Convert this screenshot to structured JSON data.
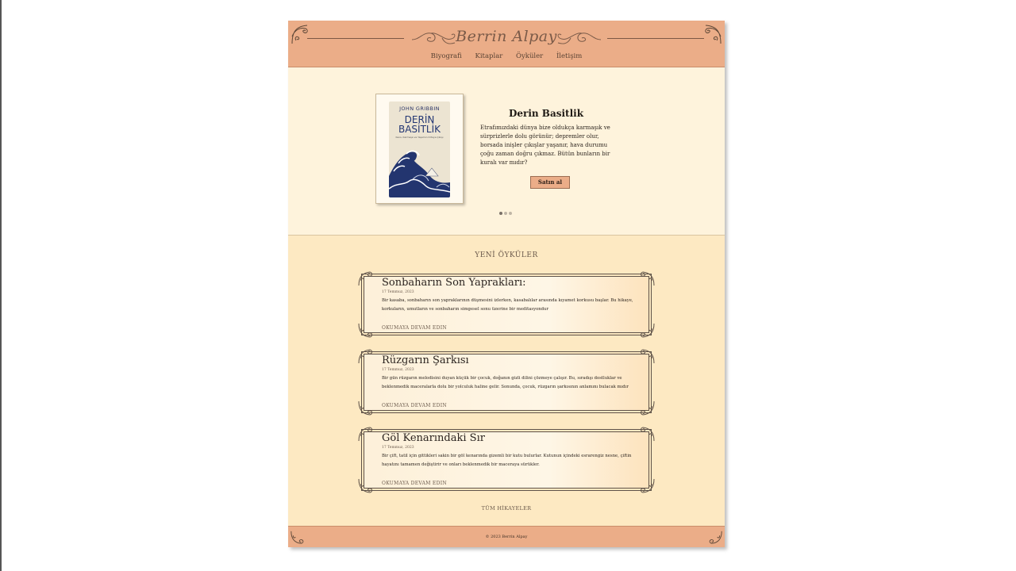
{
  "site": {
    "logo": "Berrin Alpay",
    "nav": [
      "Biyografi",
      "Kitaplar",
      "Öyküler",
      "İletişim"
    ]
  },
  "hero": {
    "cover_author": "JOHN GRIBBIN",
    "cover_title_1": "DERİN",
    "cover_title_2": "BASİTLİK",
    "cover_subtitle": "Kaos, Karmaşa ve Yaşamın Ortaya Çıkışı",
    "title": "Derin Basitlik",
    "description": "Etrafımızdaki dünya bize oldukça karmaşık ve sürprizlerle dolu görünür; depremler olur, borsada inişler çıkışlar yaşanır, hava durumu çoğu zaman doğru çıkmaz. Bütün bunların bir kuralı var mıdır?",
    "buy_label": "Satın al",
    "slides": 3,
    "active_slide": 0
  },
  "stories": {
    "section_title": "YENİ ÖYKÜLER",
    "more_label": "OKUMAYA DEVAM EDIN",
    "all_label": "TÜM HİKAYELER",
    "items": [
      {
        "title": "Sonbaharın Son Yaprakları:",
        "date": "17 Temmuz, 2023",
        "text": "Bir kasaba, sonbaharın son yapraklarının düşmesini izlerken, kasabalılar arasında kıyamet korkusu başlar. Bu hikaye, korkuların, umutların ve sonbaharın simgesel sonu üzerine bir meditasyondur"
      },
      {
        "title": "Rüzgarın Şarkısı",
        "date": "17 Temmuz, 2023",
        "text": "Bir gün rüzgarın melodisini duyan küçük bir çocuk, doğanın gizli dilini çözmeye çalışır. Bu, sıradışı dostluklar ve beklenmedik maceralarla dolu bir yolculuk haline gelir. Sonunda, çocuk, rüzgarın şarkısının anlamını bulacak mıdır"
      },
      {
        "title": "Göl Kenarındaki Sır",
        "date": "17 Temmuz, 2023",
        "text": "Bir çift, tatil için gittikleri sakin bir göl kenarında gizemli bir kutu bulurlar. Kutunun içindeki esrarengiz nesne, çiftin hayatını tamamen değiştirir ve onları beklenmedik bir maceraya sürükler."
      }
    ]
  },
  "footer": {
    "copyright": "© 2023 Berrin Alpay"
  },
  "colors": {
    "header_bg": "#ebad88",
    "hero_bg": "#fef3dc",
    "stories_bg": "#fde9c2",
    "text_dark": "#2b2420"
  }
}
